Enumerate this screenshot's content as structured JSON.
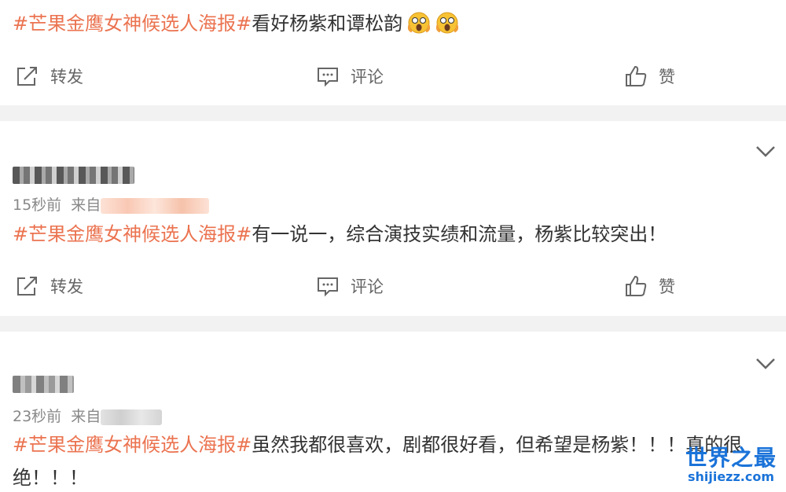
{
  "posts": [
    {
      "hashtag": "#芒果金鹰女神候选人海报#",
      "text": "看好杨紫和谭松韵",
      "emojis": [
        "scream-face-icon",
        "scream-face-icon"
      ]
    },
    {
      "time": "15秒前",
      "source_prefix": "来自",
      "hashtag": "#芒果金鹰女神候选人海报#",
      "text": "有一说一，综合演技实绩和流量，杨紫比较突出！"
    },
    {
      "time": "23秒前",
      "source_prefix": "来自",
      "hashtag": "#芒果金鹰女神候选人海报#",
      "text": "虽然我都很喜欢，剧都很好看，但希望是杨紫！！！真的很",
      "text_line2": "绝！！！"
    }
  ],
  "actions": {
    "repost": "转发",
    "comment": "评论",
    "like": "赞"
  },
  "watermark": {
    "title": "世界之最",
    "domain": "shijiezz.com"
  },
  "colors": {
    "hashtag": "#eb7350",
    "gap": "#f2f2f2",
    "watermark": "#1a73d9"
  }
}
